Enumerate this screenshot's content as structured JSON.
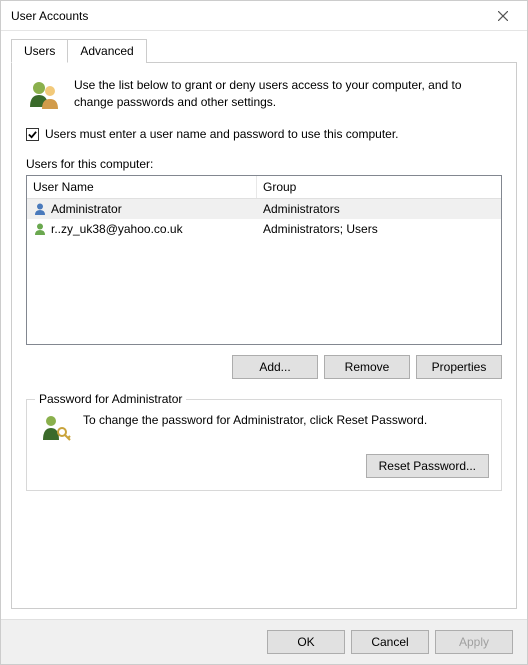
{
  "window": {
    "title": "User Accounts"
  },
  "tabs": {
    "users": "Users",
    "advanced": "Advanced"
  },
  "intro": {
    "text": "Use the list below to grant or deny users access to your computer, and to change passwords and other settings."
  },
  "checkbox": {
    "checked": true,
    "label": "Users must enter a user name and password to use this computer."
  },
  "list": {
    "label": "Users for this computer:",
    "columns": {
      "name": "User Name",
      "group": "Group"
    },
    "rows": [
      {
        "name": "Administrator",
        "group": "Administrators",
        "selected": true
      },
      {
        "name": "r..zy_uk38@yahoo.co.uk",
        "group": "Administrators; Users",
        "selected": false
      }
    ]
  },
  "buttons": {
    "add": "Add...",
    "remove": "Remove",
    "properties": "Properties"
  },
  "password_group": {
    "title": "Password for Administrator",
    "text": "To change the password for Administrator, click Reset Password.",
    "reset_btn": "Reset Password..."
  },
  "footer": {
    "ok": "OK",
    "cancel": "Cancel",
    "apply": "Apply"
  }
}
